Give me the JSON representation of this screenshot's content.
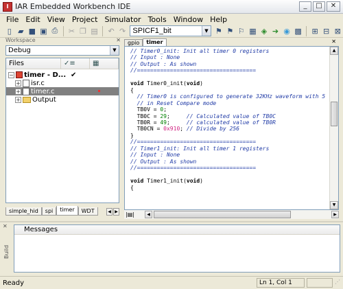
{
  "window": {
    "title": "IAR Embedded Workbench IDE"
  },
  "menubar": [
    "File",
    "Edit",
    "View",
    "Project",
    "Simulator",
    "Tools",
    "Window",
    "Help"
  ],
  "toolbar": {
    "search_value": "SPICF1_bit"
  },
  "workspace": {
    "label": "Workspace",
    "config": "Debug",
    "columns": {
      "files": "Files"
    },
    "tree": [
      {
        "label": "timer - D...",
        "kind": "project",
        "checked": true
      },
      {
        "label": "isr.c",
        "kind": "file"
      },
      {
        "label": "timer.c",
        "kind": "file",
        "selected": true
      },
      {
        "label": "Output",
        "kind": "folder"
      }
    ],
    "tabs": [
      "simple_hid",
      "spi",
      "timer",
      "WDT"
    ],
    "active_tab": "timer"
  },
  "editor": {
    "tabs": [
      "gpio",
      "timer"
    ],
    "active_tab": "timer",
    "lines": [
      [
        [
          "c",
          "// Timer0_init: Init all timer 0 registers"
        ]
      ],
      [
        [
          "c",
          "// Input : None"
        ]
      ],
      [
        [
          "c",
          "// Output : As shown"
        ]
      ],
      [
        [
          "c",
          "//===================================="
        ]
      ],
      [
        [
          "t",
          ""
        ]
      ],
      [
        [
          "k",
          "void"
        ],
        [
          "t",
          " Timer0_init("
        ],
        [
          "k",
          "void"
        ],
        [
          "t",
          ")"
        ]
      ],
      [
        [
          "t",
          "{"
        ]
      ],
      [
        [
          "c",
          "  // Timer0 is configured to generate 32KHz waveform with 5"
        ]
      ],
      [
        [
          "c",
          "  // in Reset Compare mode"
        ]
      ],
      [
        [
          "t",
          "  TB0V = "
        ],
        [
          "n",
          "0"
        ],
        [
          "t",
          ";"
        ]
      ],
      [
        [
          "t",
          "  TB0C = "
        ],
        [
          "n",
          "29"
        ],
        [
          "t",
          ";     "
        ],
        [
          "c",
          "// Calculated value of TB0C"
        ]
      ],
      [
        [
          "t",
          "  TB0R = "
        ],
        [
          "n",
          "49"
        ],
        [
          "t",
          ";     "
        ],
        [
          "c",
          "// calculated value of TB0R"
        ]
      ],
      [
        [
          "t",
          "  TB0CN = "
        ],
        [
          "h",
          "0x910"
        ],
        [
          "t",
          "; "
        ],
        [
          "c",
          "// Divide by 256"
        ]
      ],
      [
        [
          "t",
          "}"
        ]
      ],
      [
        [
          "c",
          "//===================================="
        ]
      ],
      [
        [
          "c",
          "// Timer1_init: Init all timer 1 registers"
        ]
      ],
      [
        [
          "c",
          "// Input : None"
        ]
      ],
      [
        [
          "c",
          "// Output : As shown"
        ]
      ],
      [
        [
          "c",
          "//===================================="
        ]
      ],
      [
        [
          "t",
          ""
        ]
      ],
      [
        [
          "k",
          "void"
        ],
        [
          "t",
          " Timer1_init("
        ],
        [
          "k",
          "void"
        ],
        [
          "t",
          ")"
        ]
      ],
      [
        [
          "t",
          "{"
        ]
      ]
    ]
  },
  "messages": {
    "header": "Messages",
    "panel_label": "Build"
  },
  "status": {
    "left": "Ready",
    "position": "Ln 1, Col 1"
  }
}
